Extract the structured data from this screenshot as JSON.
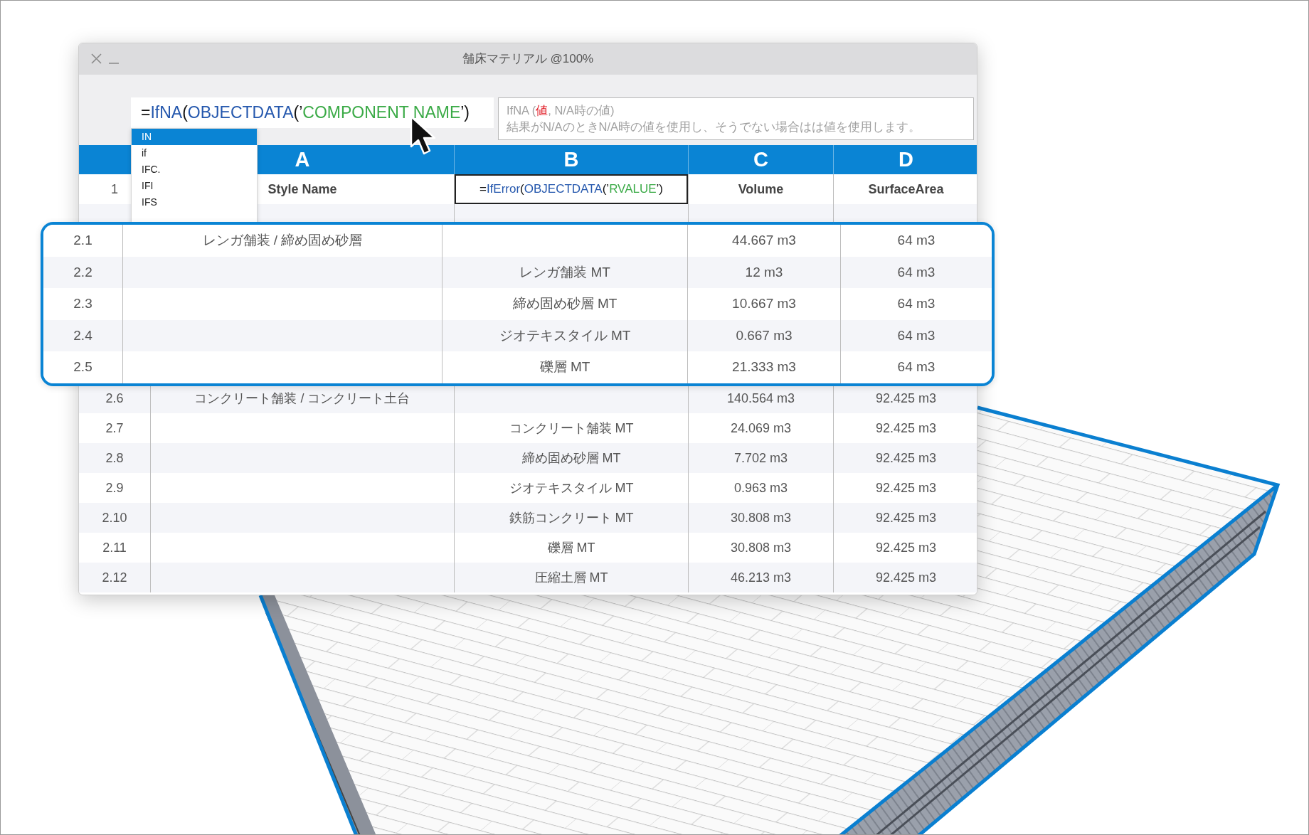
{
  "window": {
    "title": "舗床マテリアル @100%"
  },
  "formula_bar": {
    "parts": [
      {
        "text": "=",
        "kind": "plain"
      },
      {
        "text": "IfNA",
        "kind": "function"
      },
      {
        "text": "(",
        "kind": "plain"
      },
      {
        "text": "OBJECTDATA",
        "kind": "function"
      },
      {
        "text": " (’",
        "kind": "plain"
      },
      {
        "text": "COMPONENT NAME",
        "kind": "string"
      },
      {
        "text": "’)",
        "kind": "plain"
      }
    ]
  },
  "hint": {
    "signature": [
      {
        "text": "IfNA (",
        "kind": "plain"
      },
      {
        "text": "値",
        "kind": "argument"
      },
      {
        "text": ", N/A時の値)",
        "kind": "plain"
      }
    ],
    "description": "結果がN/AのときN/A時の値を使用し、そうでない場合はは値を使用します。"
  },
  "autocomplete": [
    {
      "label": "IN",
      "selected": true
    },
    {
      "label": "if",
      "selected": false
    },
    {
      "label": "IFC.",
      "selected": false
    },
    {
      "label": "IFI",
      "selected": false
    },
    {
      "label": "IFS",
      "selected": false
    }
  ],
  "columns": [
    "A",
    "B",
    "C",
    "D"
  ],
  "header_row": {
    "number": "1",
    "style_name": "Style Name",
    "b_cell_selected": true,
    "material_formula": [
      {
        "text": "=",
        "kind": "plain"
      },
      {
        "text": "IfError",
        "kind": "function"
      },
      {
        "text": "(",
        "kind": "plain"
      },
      {
        "text": "OBJECTDATA",
        "kind": "function"
      },
      {
        "text": " (’",
        "kind": "plain"
      },
      {
        "text": "RVALUE",
        "kind": "string"
      },
      {
        "text": "’)",
        "kind": "plain"
      }
    ],
    "volume": "Volume",
    "surface_area": "SurfaceArea"
  },
  "magnified_rows": [
    {
      "number": "2.1",
      "style_name": "レンガ舗装 / 締め固め砂層",
      "volume": "44.667 m3",
      "surface_area": "64 m3"
    },
    {
      "number": "2.2",
      "material": "レンガ舗装 MT",
      "volume": "12 m3",
      "surface_area": "64 m3"
    },
    {
      "number": "2.3",
      "material": "締め固め砂層 MT",
      "volume": "10.667 m3",
      "surface_area": "64 m3"
    },
    {
      "number": "2.4",
      "material": "ジオテキスタイル MT",
      "volume": "0.667 m3",
      "surface_area": "64 m3"
    },
    {
      "number": "2.5",
      "material": "礫層 MT",
      "volume": "21.333 m3",
      "surface_area": "64 m3"
    }
  ],
  "rows_below": [
    {
      "number": "2.6",
      "style_name": "コンクリート舗装 / コンクリート土台",
      "volume": "140.564 m3",
      "surface_area": "92.425 m3"
    },
    {
      "number": "2.7",
      "material": "コンクリート舗装 MT",
      "volume": "24.069 m3",
      "surface_area": "92.425 m3"
    },
    {
      "number": "2.8",
      "material": "締め固め砂層 MT",
      "volume": "7.702 m3",
      "surface_area": "92.425 m3"
    },
    {
      "number": "2.9",
      "material": "ジオテキスタイル MT",
      "volume": "0.963 m3",
      "surface_area": "92.425 m3"
    },
    {
      "number": "2.10",
      "material": "鉄筋コンクリート MT",
      "volume": "30.808 m3",
      "surface_area": "92.425 m3"
    },
    {
      "number": "2.11",
      "material": "礫層 MT",
      "volume": "30.808 m3",
      "surface_area": "92.425 m3"
    },
    {
      "number": "2.12",
      "material": "圧縮土層 MT",
      "volume": "46.213 m3",
      "surface_area": "92.425 m3"
    }
  ]
}
